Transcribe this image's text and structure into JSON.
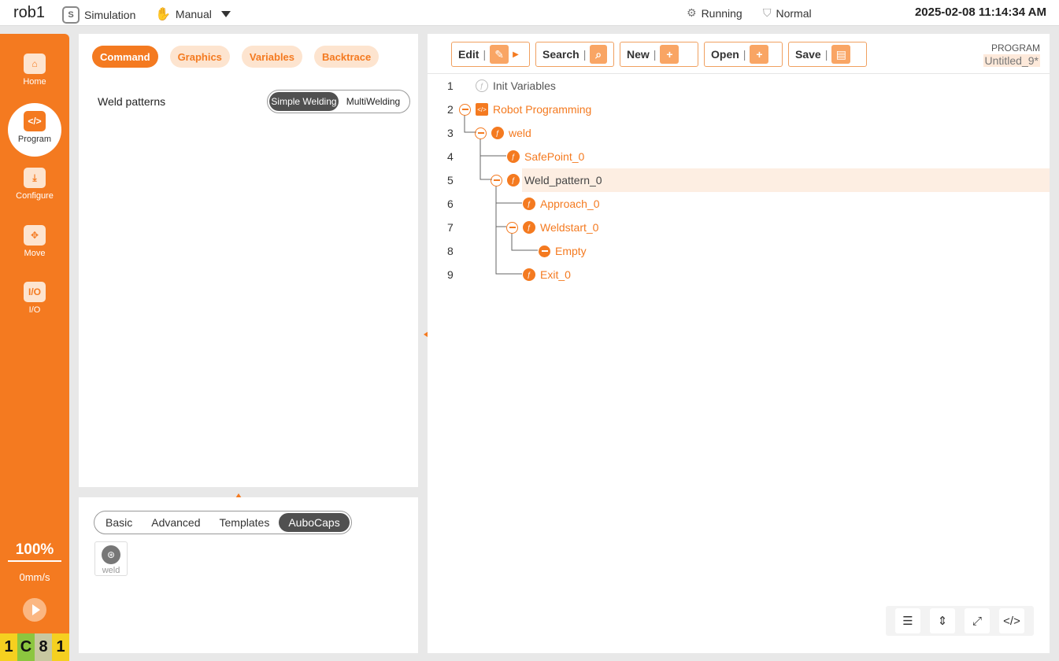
{
  "topbar": {
    "robot_name": "rob1",
    "mode": "Simulation",
    "control": "Manual",
    "status": "Running",
    "safety": "Normal",
    "datetime": "2025-02-08 11:14:34 AM"
  },
  "sidebar": {
    "items": [
      {
        "label": "Home",
        "icon": "home-icon"
      },
      {
        "label": "Program",
        "icon": "code-icon"
      },
      {
        "label": "Configure",
        "icon": "download-icon"
      },
      {
        "label": "Move",
        "icon": "move-icon"
      },
      {
        "label": "I/O",
        "icon": "io-icon"
      }
    ],
    "io_icon_text": "I/O",
    "speed_percent": "100%",
    "speed_mm": "0mm/s",
    "code": [
      "1",
      "C",
      "8",
      "1"
    ],
    "code_colors": [
      "#f5d020",
      "#8cc63f",
      "#c8c8a0",
      "#f5d020"
    ]
  },
  "left_panel": {
    "tabs": [
      "Command",
      "Graphics",
      "Variables",
      "Backtrace"
    ],
    "active_tab": "Command",
    "weld_patterns_label": "Weld patterns",
    "seg_options": [
      "Simple Welding",
      "MultiWelding"
    ],
    "seg_active": "Simple Welding"
  },
  "bottom_panel": {
    "tabs": [
      "Basic",
      "Advanced",
      "Templates",
      "AuboCaps"
    ],
    "active_tab": "AuboCaps",
    "tile_label": "weld"
  },
  "program": {
    "toolbar": [
      "Edit",
      "Search",
      "New",
      "Open",
      "Save"
    ],
    "label": "PROGRAM",
    "name": "Untitled_9*",
    "lines": [
      {
        "num": "1",
        "text": "Init Variables"
      },
      {
        "num": "2",
        "text": "Robot Programming"
      },
      {
        "num": "3",
        "text": "weld"
      },
      {
        "num": "4",
        "text": "SafePoint_0"
      },
      {
        "num": "5",
        "text": "Weld_pattern_0"
      },
      {
        "num": "6",
        "text": "Approach_0"
      },
      {
        "num": "7",
        "text": "Weldstart_0"
      },
      {
        "num": "8",
        "text": "Empty"
      },
      {
        "num": "9",
        "text": "Exit_0"
      }
    ],
    "selected_line": "5"
  },
  "colors": {
    "accent": "#f47a20",
    "accent_light": "#fde4cf",
    "selected_row": "#fdeee2"
  }
}
